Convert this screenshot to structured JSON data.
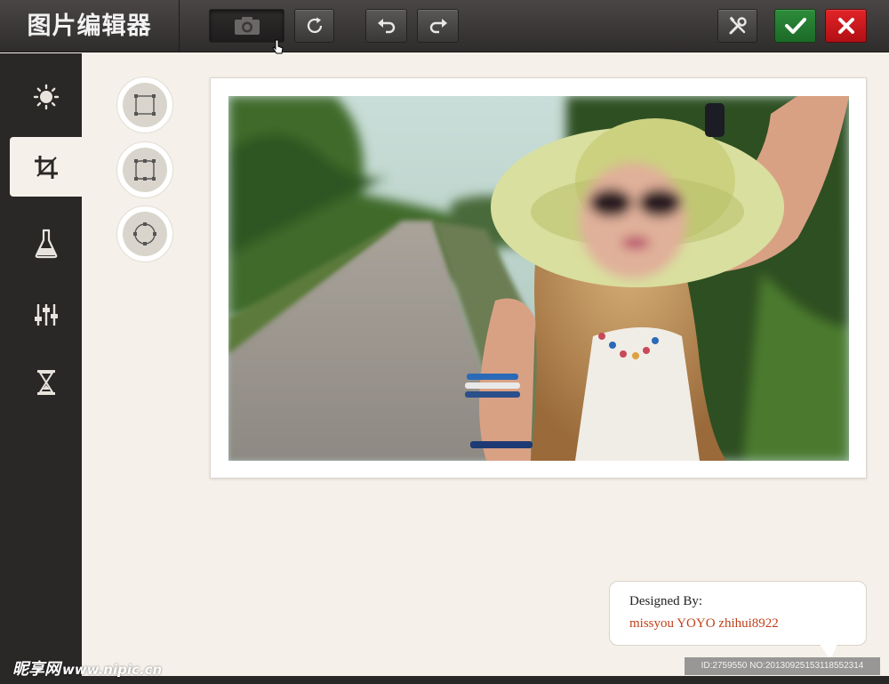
{
  "app": {
    "title": "图片编辑器"
  },
  "toolbar": {
    "buttons": [
      "camera-icon",
      "refresh-icon",
      "undo-icon",
      "redo-icon",
      "tools-icon",
      "check-icon",
      "close-icon"
    ],
    "confirm_color": "#2c8c3a",
    "cancel_color": "#e22428"
  },
  "sidebar": {
    "items": [
      {
        "icon": "brightness-icon",
        "active": false
      },
      {
        "icon": "crop-icon",
        "active": true
      },
      {
        "icon": "flask-icon",
        "active": false
      },
      {
        "icon": "sliders-icon",
        "active": false
      },
      {
        "icon": "hourglass-icon",
        "active": false
      }
    ]
  },
  "crop_shapes": [
    "square-crop-icon",
    "rounded-square-crop-icon",
    "circle-crop-icon"
  ],
  "credit": {
    "line1": "Designed By:",
    "line2": "missyou YOYO zhihui8922"
  },
  "watermark": {
    "logo": "昵享网",
    "url": "www.nipic.cn",
    "id": "ID:2759550 NO:20130925153118552314"
  }
}
